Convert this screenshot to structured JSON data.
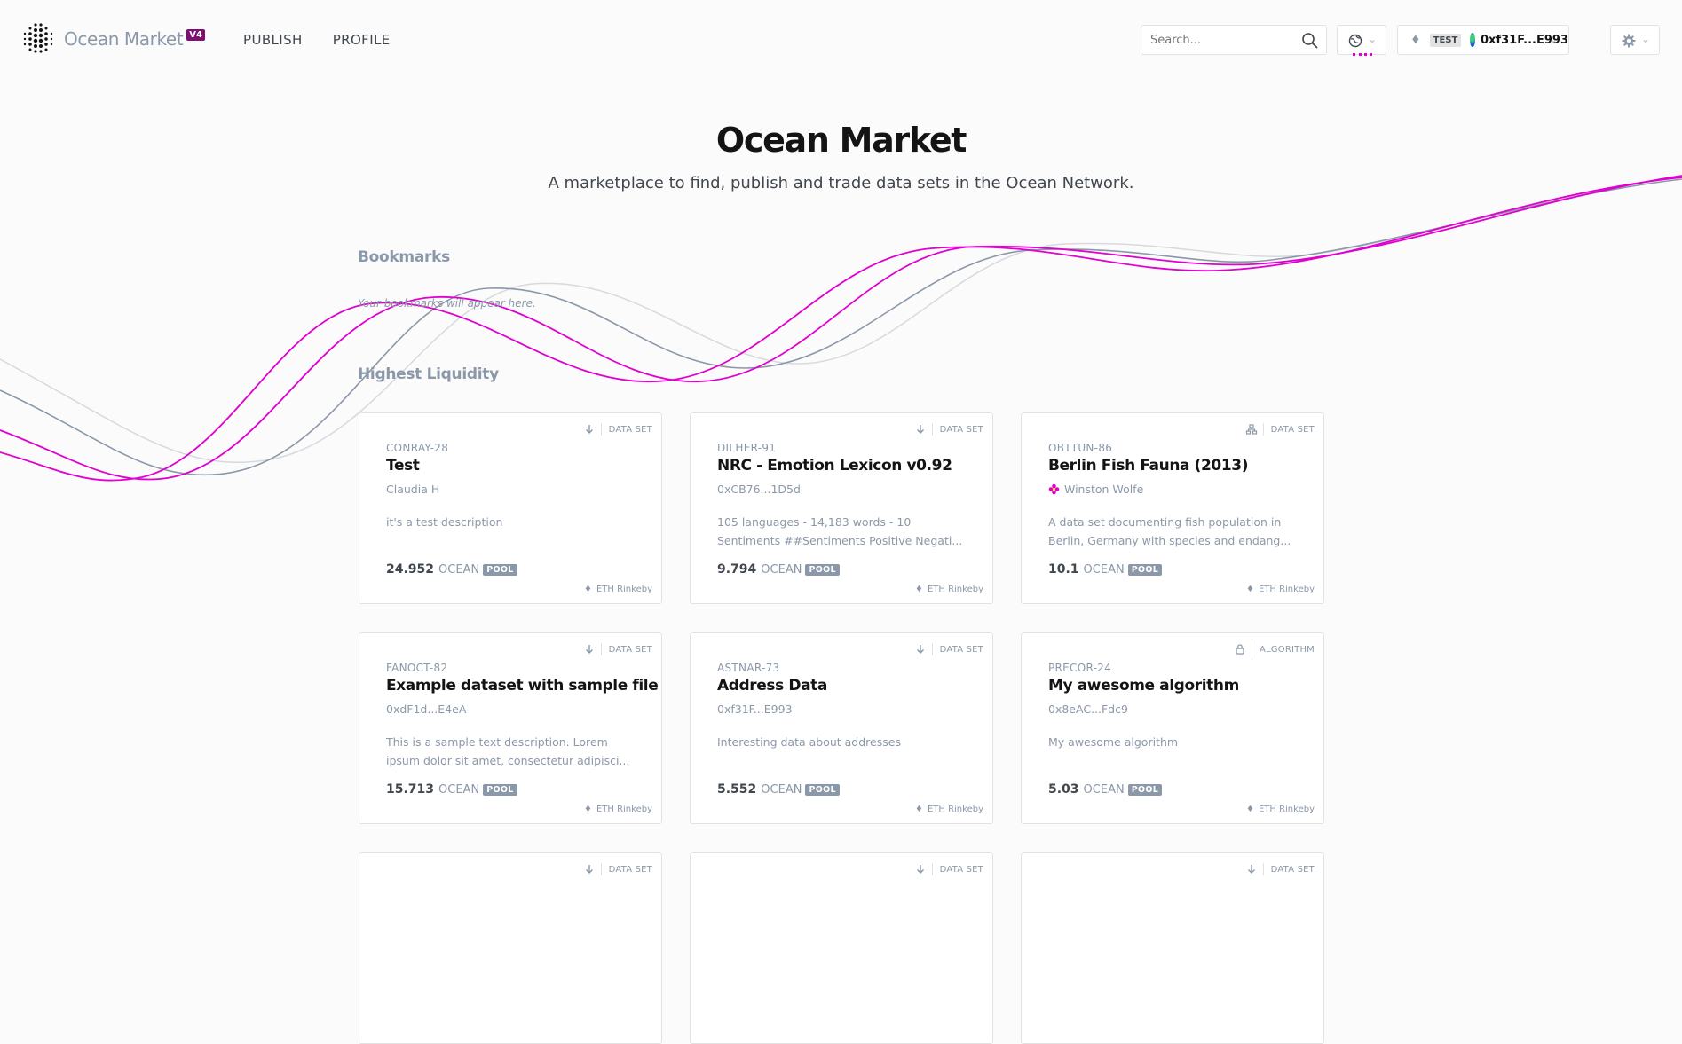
{
  "brand": {
    "name": "Ocean Market",
    "version": "V4"
  },
  "nav": [
    {
      "label": "PUBLISH"
    },
    {
      "label": "PROFILE"
    }
  ],
  "search": {
    "placeholder": "Search..."
  },
  "wallet": {
    "eth_icon": "ethereum-icon",
    "network_badge": "TEST",
    "address": "0xf31F...E993"
  },
  "hero": {
    "title": "Ocean Market",
    "subtitle": "A marketplace to find, publish and trade data sets in the Ocean Network."
  },
  "bookmarks": {
    "title": "Bookmarks",
    "empty": "Your bookmarks will appear here."
  },
  "liquidity": {
    "title": "Highest Liquidity",
    "cards": [
      {
        "type": "DATA SET",
        "access_icon": "download-icon",
        "symbol": "CONRAY-28",
        "name": "Test",
        "owner": "Claudia H",
        "description": "it's a test description",
        "price": "24.952",
        "currency": "OCEAN",
        "badge": "POOL",
        "network": "ETH Rinkeby"
      },
      {
        "type": "DATA SET",
        "access_icon": "download-icon",
        "symbol": "DILHER-91",
        "name": "NRC - Emotion Lexicon v0.92",
        "owner": "0xCB76...1D5d",
        "description": "105 languages - 14,183 words - 10 Sentiments ##Sentiments Positive Negati...",
        "price": "9.794",
        "currency": "OCEAN",
        "badge": "POOL",
        "network": "ETH Rinkeby"
      },
      {
        "type": "DATA SET",
        "access_icon": "compute-icon",
        "symbol": "OBTTUN-86",
        "name": "Berlin Fish Fauna (2013)",
        "owner": "Winston Wolfe",
        "description": "A data set documenting fish population in Berlin, Germany with species and endang...",
        "price": "10.1",
        "currency": "OCEAN",
        "badge": "POOL",
        "network": "ETH Rinkeby"
      },
      {
        "type": "DATA SET",
        "access_icon": "download-icon",
        "symbol": "FANOCT-82",
        "name": "Example dataset with sample file",
        "owner": "0xdF1d...E4eA",
        "description": "This is a sample text description. Lorem ipsum dolor sit amet, consectetur adipisci...",
        "price": "15.713",
        "currency": "OCEAN",
        "badge": "POOL",
        "network": "ETH Rinkeby"
      },
      {
        "type": "DATA SET",
        "access_icon": "download-icon",
        "symbol": "ASTNAR-73",
        "name": "Address Data",
        "owner": "0xf31F...E993",
        "description": "Interesting data about addresses",
        "price": "5.552",
        "currency": "OCEAN",
        "badge": "POOL",
        "network": "ETH Rinkeby"
      },
      {
        "type": "ALGORITHM",
        "access_icon": "lock-icon",
        "symbol": "PRECOR-24",
        "name": "My awesome algorithm",
        "owner": "0x8eAC...Fdc9",
        "description": "My awesome algorithm",
        "price": "5.03",
        "currency": "OCEAN",
        "badge": "POOL",
        "network": "ETH Rinkeby"
      },
      {
        "type": "DATA SET",
        "access_icon": "download-icon"
      },
      {
        "type": "DATA SET",
        "access_icon": "download-icon"
      },
      {
        "type": "DATA SET",
        "access_icon": "download-icon"
      }
    ]
  },
  "colors": {
    "accent": "#e000cf",
    "muted": "#8b98a9",
    "text": "#141414",
    "border": "#e2e2e2"
  }
}
